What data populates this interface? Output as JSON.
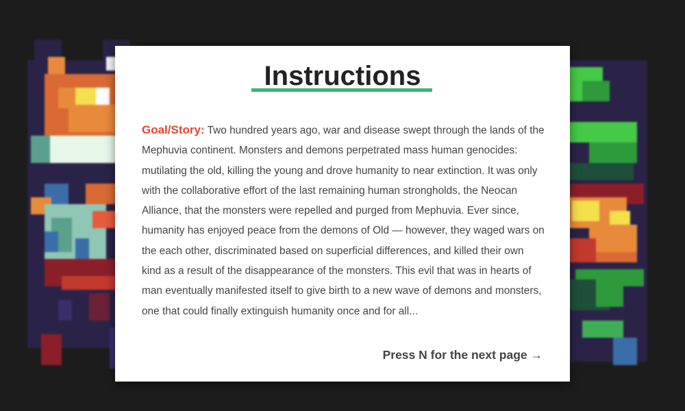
{
  "screen": {
    "background_color": "#1c1c1c"
  },
  "instructions": {
    "title": "Instructions",
    "accent_color": "#3cb371",
    "story_label": "Goal/Story:",
    "story_label_color": "#e8432e",
    "story_text": "Two hundred years ago, war and disease swept through the lands of the Mephuvia continent. Monsters and demons perpetrated mass human genocides: mutilating the old, killing the young and drove humanity to near extinction. It was only with the collaborative effort of the last remaining human strongholds, the Neocan Alliance, that the monsters were repelled and purged from Mephuvia. Ever since, humanity has enjoyed peace from the demons of Old —  however, they waged wars on the each other, discriminated based on superficial differences, and killed their own kind as a result of the disappearance of the monsters. This evil that was in hearts of man eventually manifested itself to give birth to a new wave of demons and monsters, one that could finally extinguish humanity once and for all...",
    "next_hint": "Press N for the next page →"
  },
  "background_sprites": {
    "left": "pixel-art-demon-sprite",
    "right": "pixel-art-monster-sprite"
  }
}
